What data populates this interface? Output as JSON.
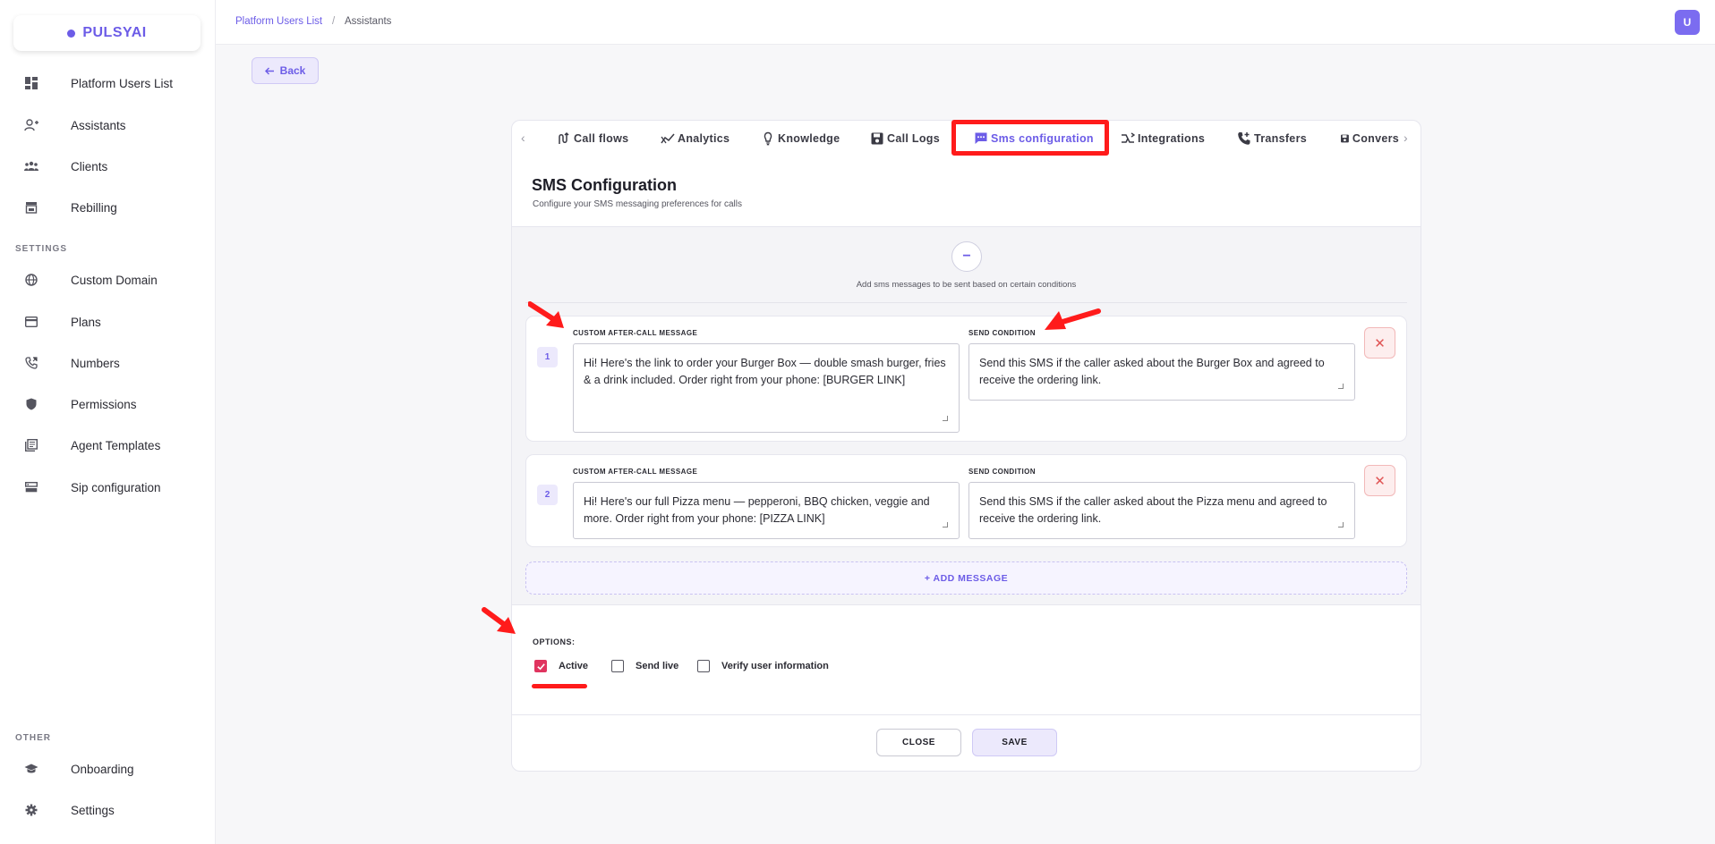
{
  "brand": {
    "name": "PULSYAI",
    "color": "#6c5ce7"
  },
  "sidebar": {
    "items": [
      {
        "label": "Platform Users List",
        "icon": "dashboard-icon"
      },
      {
        "label": "Assistants",
        "icon": "user-plus-icon"
      },
      {
        "label": "Clients",
        "icon": "group-icon"
      },
      {
        "label": "Rebilling",
        "icon": "store-icon"
      }
    ],
    "settings_label": "SETTINGS",
    "settings_items": [
      {
        "label": "Custom Domain",
        "icon": "globe-icon"
      },
      {
        "label": "Plans",
        "icon": "credit-card-icon"
      },
      {
        "label": "Numbers",
        "icon": "phone-icon"
      },
      {
        "label": "Permissions",
        "icon": "shield-icon"
      },
      {
        "label": "Agent Templates",
        "icon": "library-icon"
      },
      {
        "label": "Sip configuration",
        "icon": "server-icon"
      }
    ],
    "other_label": "OTHER",
    "other_items": [
      {
        "label": "Onboarding",
        "icon": "graduation-cap-icon"
      },
      {
        "label": "Settings",
        "icon": "gear-icon"
      }
    ]
  },
  "header": {
    "breadcrumb_link": "Platform Users List",
    "breadcrumb_sep": "/",
    "breadcrumb_current": "Assistants",
    "avatar": "U"
  },
  "back_label": "Back",
  "tabs": {
    "items": [
      "Call flows",
      "Analytics",
      "Knowledge",
      "Call Logs",
      "Sms configuration",
      "Integrations",
      "Transfers",
      "Convers"
    ],
    "active": "Sms configuration"
  },
  "sms": {
    "title": "SMS Configuration",
    "subtitle": "Configure your SMS messaging preferences for calls",
    "collapse_symbol": "−",
    "hint": "Add sms messages to be sent based on certain conditions",
    "message_label": "CUSTOM AFTER-CALL MESSAGE",
    "condition_label": "SEND CONDITION",
    "messages": [
      {
        "index": "1",
        "message": "Hi! Here's the link to order your Burger Box — double smash burger, fries & a drink included. Order right from your phone: [BURGER LINK]",
        "condition": "Send this SMS if the caller asked about the Burger Box and agreed to receive the ordering link."
      },
      {
        "index": "2",
        "message": "Hi! Here's our full Pizza menu — pepperoni, BBQ chicken, veggie and more. Order right from your phone: [PIZZA LINK]",
        "condition": "Send this SMS if the caller asked about the Pizza menu and agreed to receive the ordering link."
      }
    ],
    "delete_symbol": "✕",
    "add_label": "+ ADD MESSAGE"
  },
  "options": {
    "label": "OPTIONS:",
    "items": [
      {
        "label": "Active",
        "checked": true
      },
      {
        "label": "Send live",
        "checked": false
      },
      {
        "label": "Verify user information",
        "checked": false
      }
    ]
  },
  "footer": {
    "close_label": "CLOSE",
    "save_label": "SAVE"
  },
  "colors": {
    "accent": "#6c5ce7",
    "annotation_red": "#ff1b1b",
    "checkbox_checked": "#e0345f"
  }
}
